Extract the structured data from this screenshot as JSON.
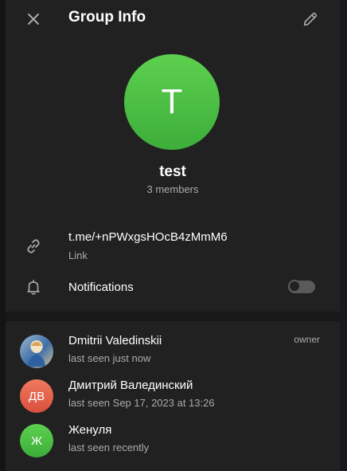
{
  "header": {
    "title": "Group Info",
    "close_icon": "close-icon",
    "edit_icon": "pencil-icon"
  },
  "group": {
    "avatar_letter": "T",
    "avatar_color": "#4fbf45",
    "name": "test",
    "members_text": "3 members"
  },
  "info": {
    "link": {
      "icon": "link-icon",
      "value": "t.me/+nPWxgsHOcB4zMmM6",
      "label": "Link"
    },
    "notifications": {
      "icon": "bell-icon",
      "label": "Notifications",
      "enabled": false
    }
  },
  "members": [
    {
      "name": "Dmitrii Valedinskii",
      "status": "last seen just now",
      "role": "owner",
      "avatar_type": "photo",
      "avatar_color": "#6b8fb5"
    },
    {
      "name": "Дмитрий Валединский",
      "status": "last seen Sep 17, 2023 at 13:26",
      "initials": "ДВ",
      "avatar_color": "#e5624d"
    },
    {
      "name": "Женуля",
      "status": "last seen recently",
      "initials": "Ж",
      "avatar_color": "#49b83f"
    }
  ],
  "colors": {
    "panel_bg": "#212121",
    "text_primary": "#ffffff",
    "text_secondary": "#aaaaaa"
  }
}
